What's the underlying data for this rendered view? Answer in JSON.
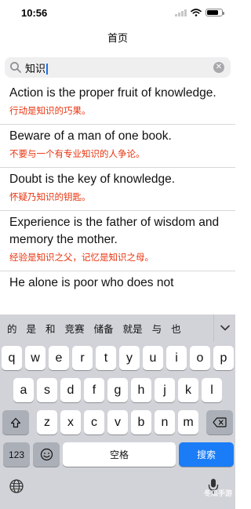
{
  "status": {
    "time": "10:56"
  },
  "nav": {
    "title": "首页"
  },
  "search": {
    "value": "知识"
  },
  "quotes": [
    {
      "en": "Action is the proper fruit of knowledge.",
      "cn": "行动是知识的巧果。"
    },
    {
      "en": "Beware of a man of one book.",
      "cn": "不要与一个有专业知识的人争论。"
    },
    {
      "en": "Doubt is the key of knowledge.",
      "cn": "怀疑乃知识的钥匙。"
    },
    {
      "en": "Experience is the father of wisdom and memory the mother.",
      "cn": "经验是知识之父，记忆是知识之母。"
    },
    {
      "en": "He alone is poor who does not",
      "cn": ""
    }
  ],
  "keyboard": {
    "candidates": [
      "的",
      "是",
      "和",
      "竞赛",
      "储备",
      "就是",
      "与",
      "也"
    ],
    "row1": [
      "q",
      "w",
      "e",
      "r",
      "t",
      "y",
      "u",
      "i",
      "o",
      "p"
    ],
    "row2": [
      "a",
      "s",
      "d",
      "f",
      "g",
      "h",
      "j",
      "k",
      "l"
    ],
    "row3": [
      "z",
      "x",
      "c",
      "v",
      "b",
      "n",
      "m"
    ],
    "num_key": "123",
    "space_label": "空格",
    "search_label": "搜索"
  },
  "watermark": "冬瓜手游"
}
